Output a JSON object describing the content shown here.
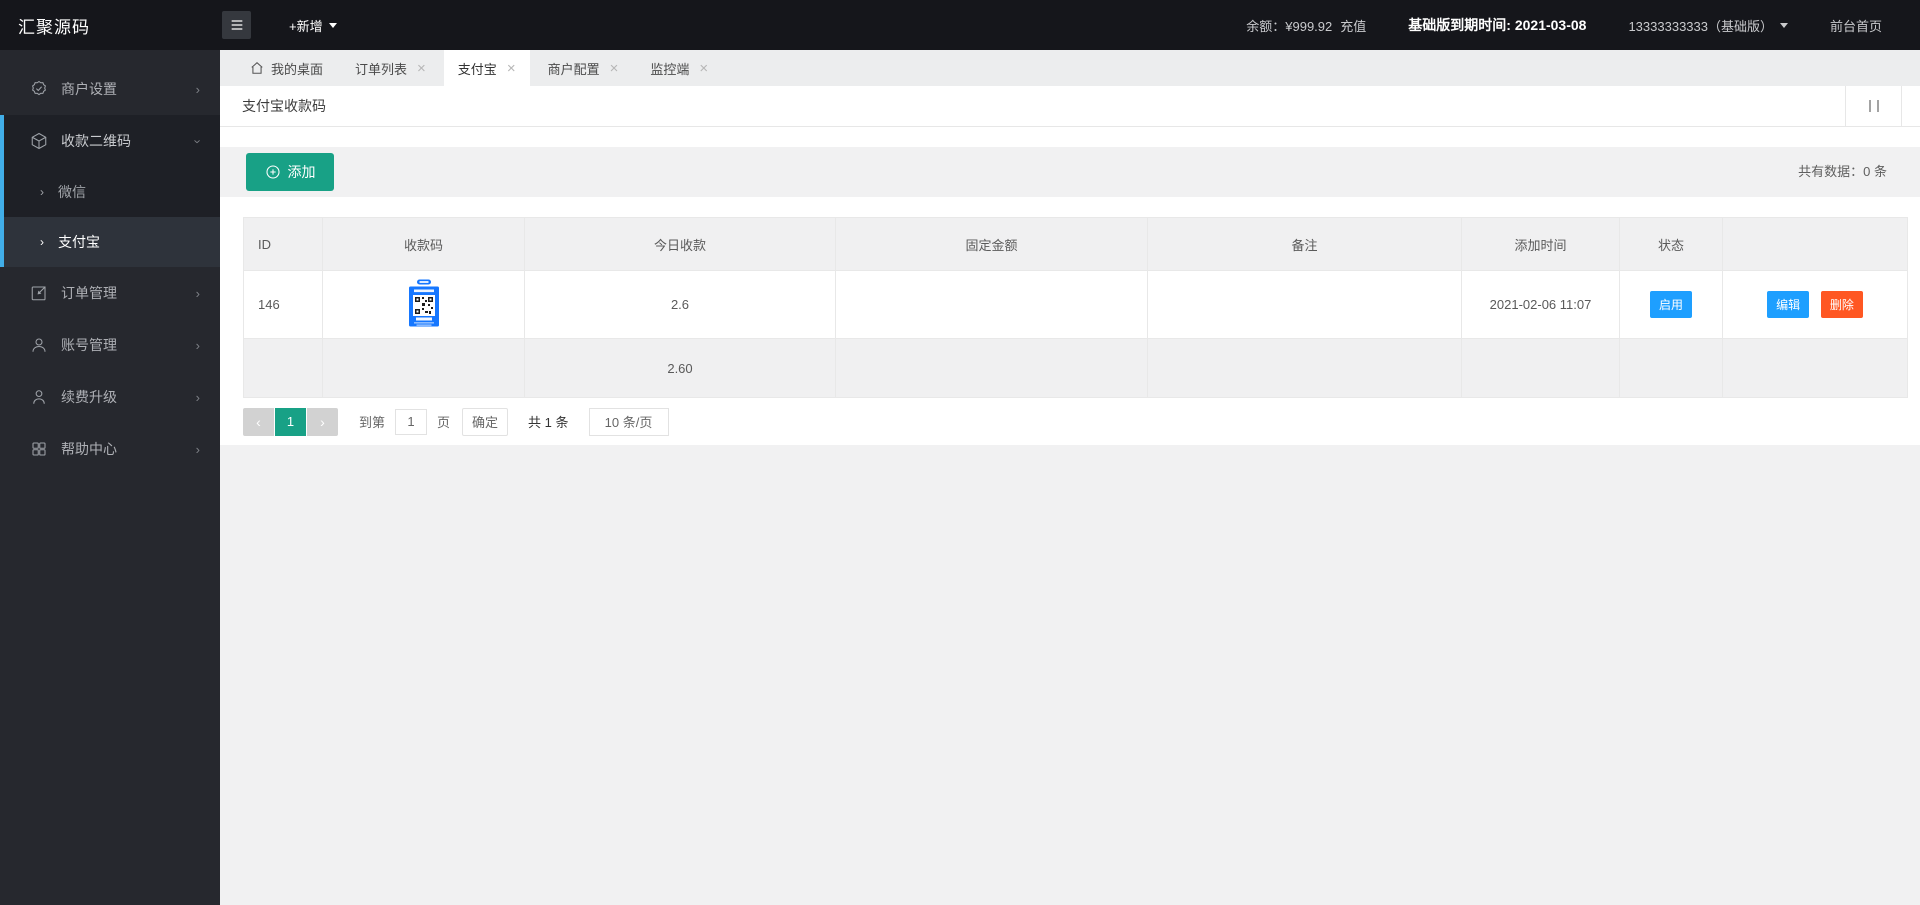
{
  "navbar": {
    "logo": "汇聚源码",
    "new_button_label": "+新增",
    "balance_label": "余额：¥999.92",
    "recharge_label": "充值",
    "expire_text": "基础版到期时间: 2021-03-08",
    "account_label": "13333333333（基础版）",
    "front_home_label": "前台首页"
  },
  "sidebar": {
    "items": [
      {
        "label": "商户设置"
      },
      {
        "label": "收款二维码",
        "children": [
          {
            "label": "微信"
          },
          {
            "label": "支付宝"
          }
        ]
      },
      {
        "label": "订单管理"
      },
      {
        "label": "账号管理"
      },
      {
        "label": "续费升级"
      },
      {
        "label": "帮助中心"
      }
    ]
  },
  "tabs": [
    {
      "label": "我的桌面"
    },
    {
      "label": "订单列表"
    },
    {
      "label": "支付宝"
    },
    {
      "label": "商户配置"
    },
    {
      "label": "监控端"
    }
  ],
  "page": {
    "title": "支付宝收款码"
  },
  "toolbar": {
    "add_label": "添加",
    "total_text": "共有数据：0 条"
  },
  "table": {
    "headers": [
      "ID",
      "收款码",
      "今日收款",
      "固定金额",
      "备注",
      "添加时间",
      "状态",
      ""
    ],
    "row": {
      "id": "146",
      "qr_icon": "alipay-qr-code",
      "today_income": "2.6",
      "fixed_amount": "",
      "remark": "",
      "added_time": "2021-02-06 11:07",
      "status_label": "启用",
      "edit_label": "编辑",
      "delete_label": "删除"
    },
    "summary": {
      "today_income_total": "2.60"
    }
  },
  "pagination": {
    "current_page": "1",
    "goto_prefix": "到第",
    "page_input_value": "1",
    "page_suffix": "页",
    "confirm_label": "确定",
    "total_text": "共 1 条",
    "page_size_label": "10 条/页"
  },
  "colors": {
    "accent_teal": "#18A186",
    "link_blue": "#1E9FFF",
    "danger_orange": "#FF5722",
    "sidebar_accent": "#41AEE8",
    "alipay_blue": "#1677FF"
  }
}
